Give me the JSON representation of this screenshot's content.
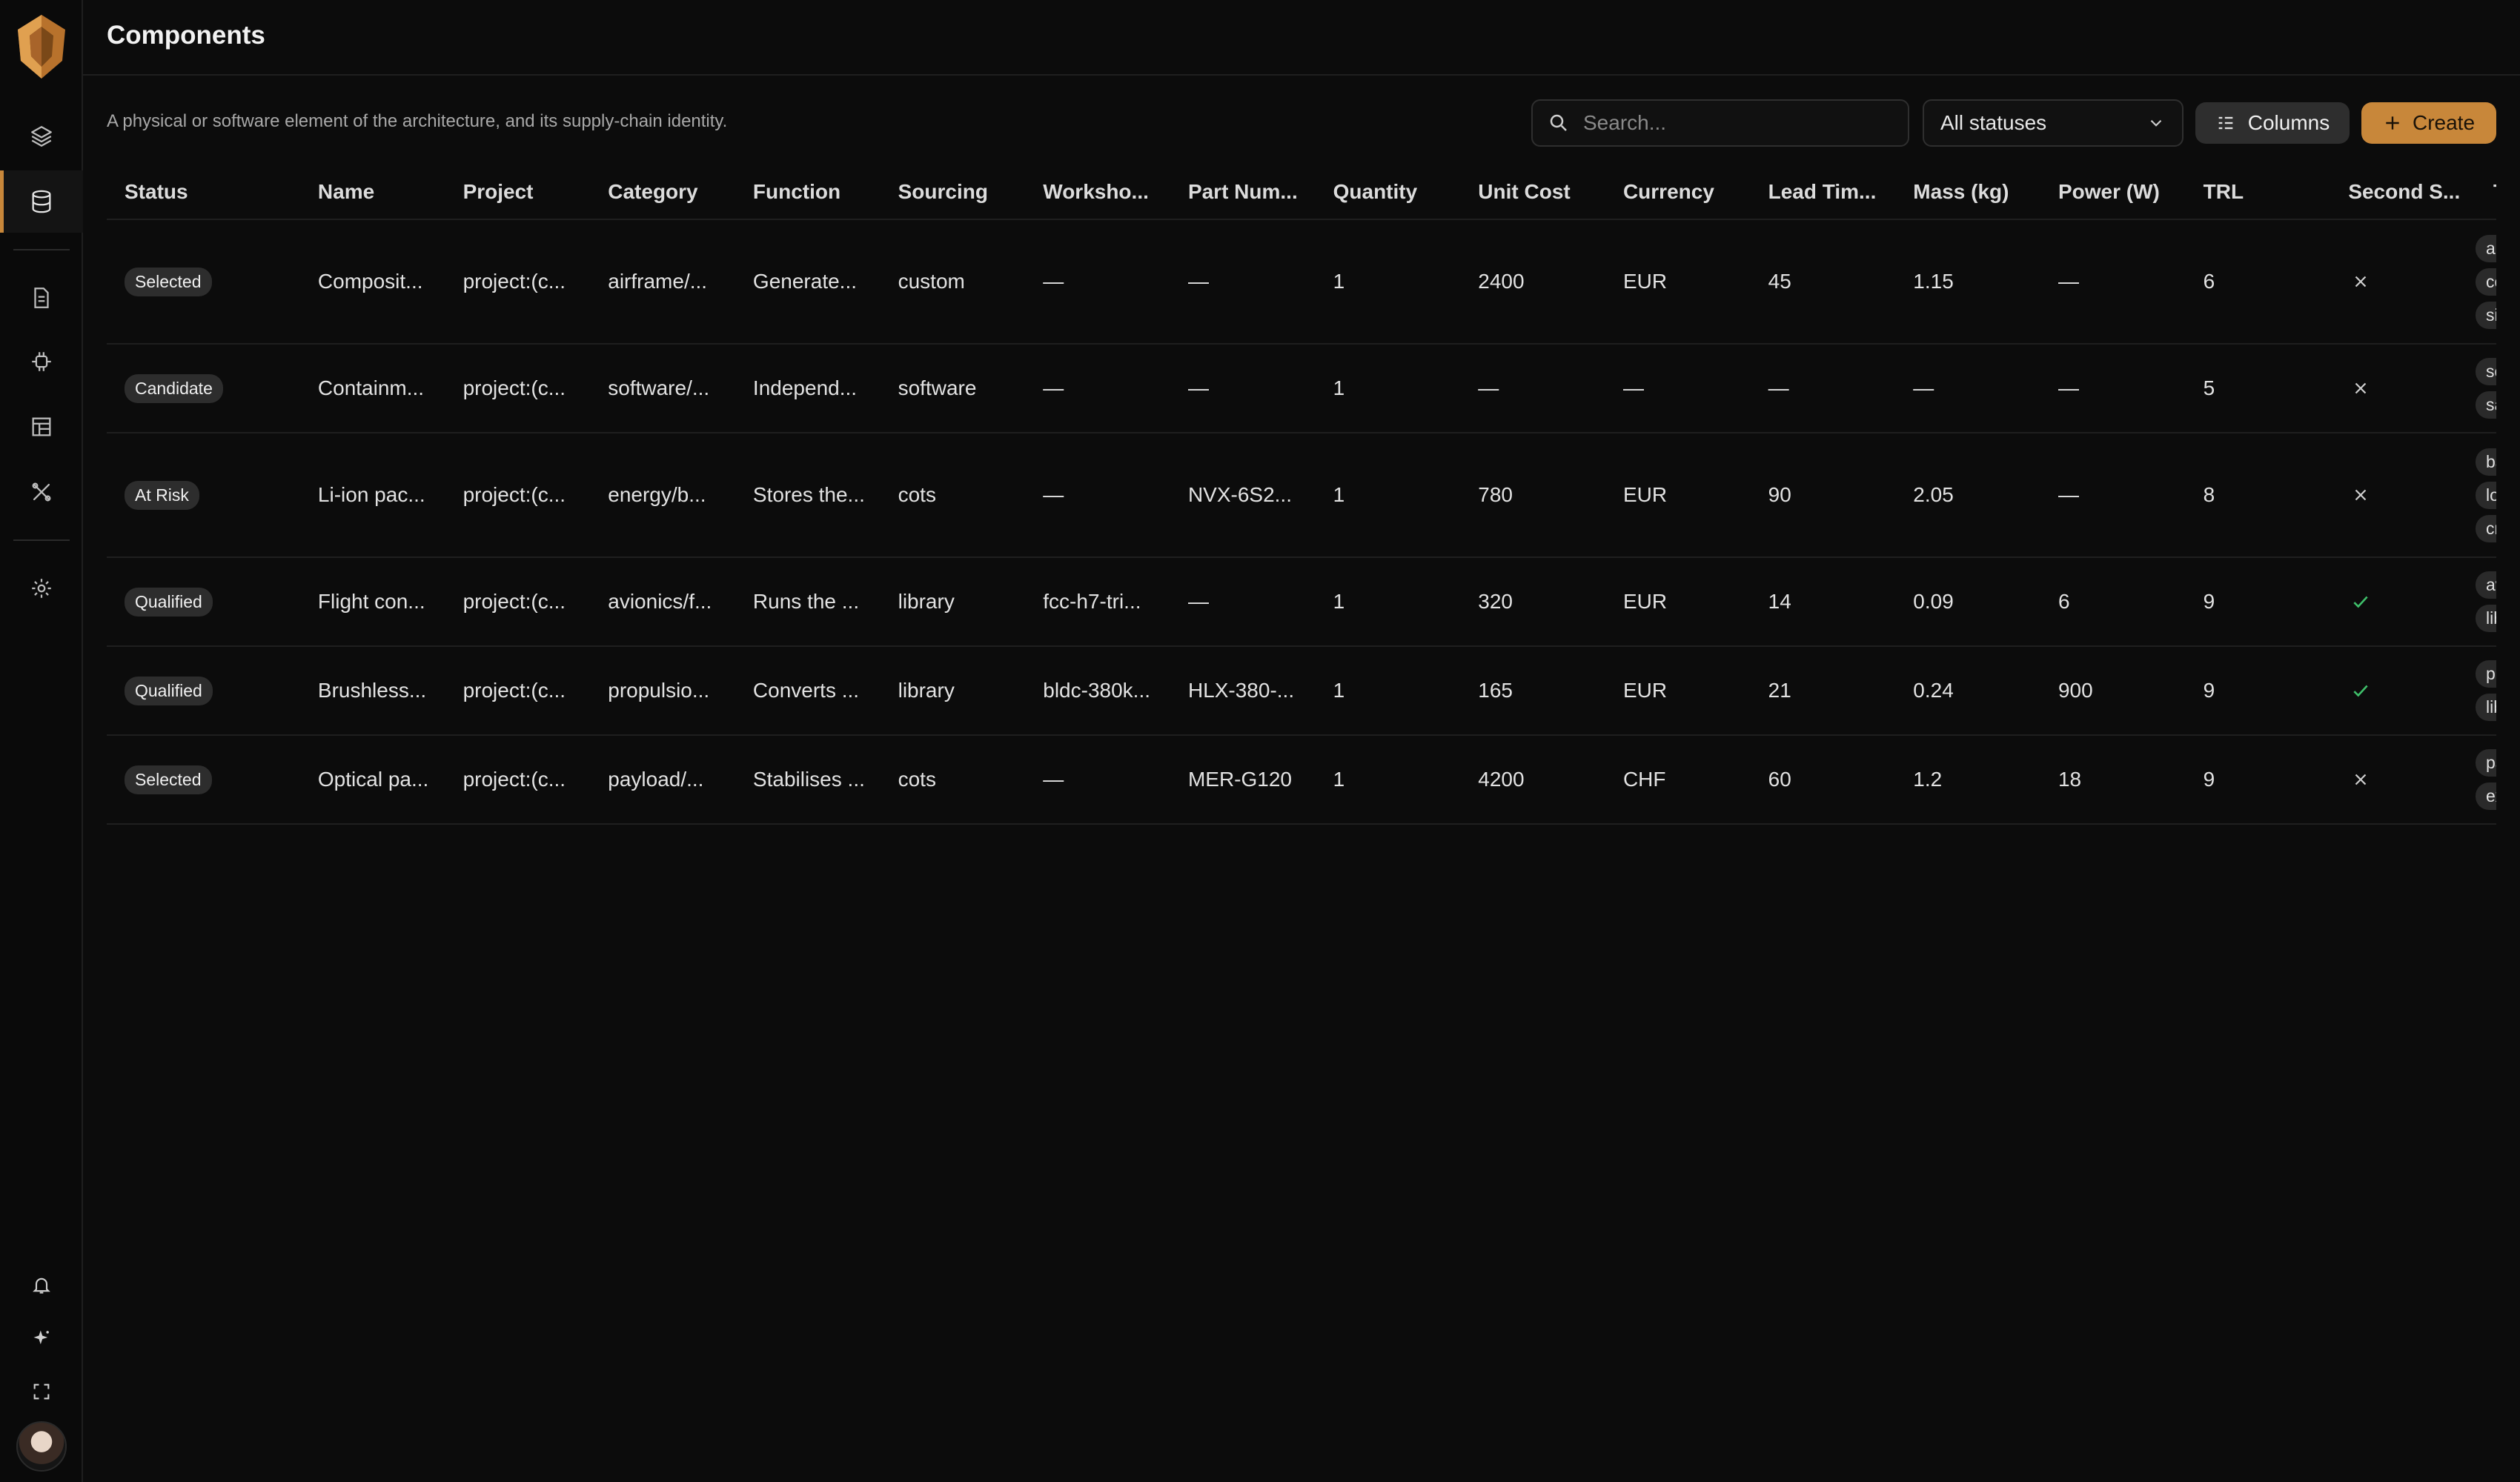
{
  "header": {
    "title": "Components"
  },
  "description": "A physical or software element of the architecture, and its supply-chain identity.",
  "search": {
    "placeholder": "Search...",
    "value": ""
  },
  "status_filter": {
    "selected": "All statuses"
  },
  "toolbar": {
    "columns_label": "Columns",
    "create_label": "Create"
  },
  "brand": {
    "accent": "#c8873a",
    "background": "#0c0c0c"
  },
  "sidebar": {
    "items": [
      {
        "icon": "layers-icon",
        "active": false
      },
      {
        "icon": "database-icon",
        "active": true
      },
      {
        "icon": "document-icon",
        "active": false
      },
      {
        "icon": "chip-icon",
        "active": false
      },
      {
        "icon": "layout-icon",
        "active": false
      },
      {
        "icon": "tools-icon",
        "active": false
      },
      {
        "icon": "gear-icon",
        "active": false
      }
    ],
    "bottom": [
      "bell-icon",
      "sparkle-icon",
      "expand-icon",
      "avatar"
    ]
  },
  "table": {
    "columns": [
      "Status",
      "Name",
      "Project",
      "Category",
      "Function",
      "Sourcing",
      "Worksho...",
      "Part Num...",
      "Quantity",
      "Unit Cost",
      "Currency",
      "Lead Tim...",
      "Mass (kg)",
      "Power (W)",
      "TRL",
      "Second S...",
      "Tags"
    ],
    "rows": [
      {
        "status": "Selected",
        "name": "Composit...",
        "project": "project:(c...",
        "category": "airframe/...",
        "function": "Generate...",
        "sourcing": "custom",
        "workshop": "—",
        "part_number": "—",
        "quantity": "1",
        "unit_cost": "2400",
        "currency": "EUR",
        "lead_time": "45",
        "mass": "1.15",
        "power": "—",
        "trl": "6",
        "second_source": "no",
        "tags": [
          "airfra",
          "com",
          "sing"
        ]
      },
      {
        "status": "Candidate",
        "name": "Containm...",
        "project": "project:(c...",
        "category": "software/...",
        "function": "Independ...",
        "sourcing": "software",
        "workshop": "—",
        "part_number": "—",
        "quantity": "1",
        "unit_cost": "—",
        "currency": "—",
        "lead_time": "—",
        "mass": "—",
        "power": "—",
        "trl": "5",
        "second_source": "no",
        "tags": [
          "softw",
          "safet"
        ]
      },
      {
        "status": "At Risk",
        "name": "Li-ion pac...",
        "project": "project:(c...",
        "category": "energy/b...",
        "function": "Stores the...",
        "sourcing": "cots",
        "workshop": "—",
        "part_number": "NVX-6S2...",
        "quantity": "1",
        "unit_cost": "780",
        "currency": "EUR",
        "lead_time": "90",
        "mass": "2.05",
        "power": "—",
        "trl": "8",
        "second_source": "no",
        "tags": [
          "batte",
          "long",
          "critic"
        ]
      },
      {
        "status": "Qualified",
        "name": "Flight con...",
        "project": "project:(c...",
        "category": "avionics/f...",
        "function": "Runs the ...",
        "sourcing": "library",
        "workshop": "fcc-h7-tri...",
        "part_number": "—",
        "quantity": "1",
        "unit_cost": "320",
        "currency": "EUR",
        "lead_time": "14",
        "mass": "0.09",
        "power": "6",
        "trl": "9",
        "second_source": "yes",
        "tags": [
          "avion",
          "libra"
        ]
      },
      {
        "status": "Qualified",
        "name": "Brushless...",
        "project": "project:(c...",
        "category": "propulsio...",
        "function": "Converts ...",
        "sourcing": "library",
        "workshop": "bldc-380k...",
        "part_number": "HLX-380-...",
        "quantity": "1",
        "unit_cost": "165",
        "currency": "EUR",
        "lead_time": "21",
        "mass": "0.24",
        "power": "900",
        "trl": "9",
        "second_source": "yes",
        "tags": [
          "prop",
          "libra"
        ]
      },
      {
        "status": "Selected",
        "name": "Optical pa...",
        "project": "project:(c...",
        "category": "payload/...",
        "function": "Stabilises ...",
        "sourcing": "cots",
        "workshop": "—",
        "part_number": "MER-G120",
        "quantity": "1",
        "unit_cost": "4200",
        "currency": "CHF",
        "lead_time": "60",
        "mass": "1.2",
        "power": "18",
        "trl": "9",
        "second_source": "no",
        "tags": [
          "paylo",
          "expo"
        ]
      }
    ]
  }
}
